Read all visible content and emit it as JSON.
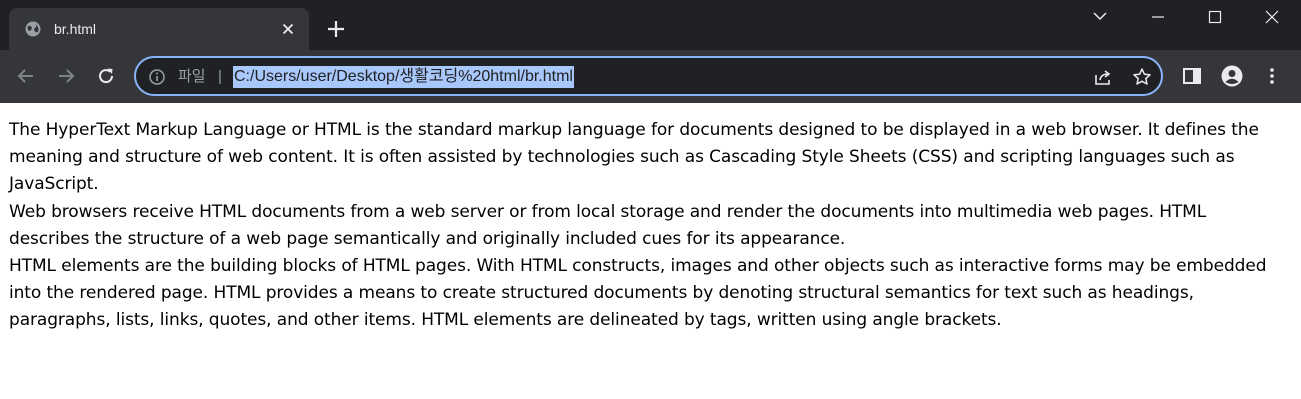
{
  "tab": {
    "title": "br.html",
    "favicon": "globe-icon"
  },
  "window_controls": [
    "chevron-down-icon",
    "minimize-icon",
    "maximize-icon",
    "close-icon"
  ],
  "toolbar": {
    "back": "back-arrow-icon",
    "forward": "forward-arrow-icon",
    "reload": "reload-icon"
  },
  "omnibox": {
    "scheme_label": "파일",
    "separator": "|",
    "url": "C:/Users/user/Desktop/생활코딩%20html/br.html",
    "highlight_color": "#a8c7fa",
    "border_color": "#8ab4f8"
  },
  "content": {
    "lines": [
      "The HyperText Markup Language or HTML is the standard markup language for documents designed to be displayed in a web browser. It defines the meaning and structure of web content. It is often assisted by technologies such as Cascading Style Sheets (CSS) and scripting languages such as JavaScript.",
      "Web browsers receive HTML documents from a web server or from local storage and render the documents into multimedia web pages. HTML describes the structure of a web page semantically and originally included cues for its appearance.",
      "HTML elements are the building blocks of HTML pages. With HTML constructs, images and other objects such as interactive forms may be embedded into the rendered page. HTML provides a means to create structured documents by denoting structural semantics for text such as headings, paragraphs, lists, links, quotes, and other items. HTML elements are delineated by tags, written using angle brackets."
    ]
  },
  "colors": {
    "tabstrip_bg": "#202124",
    "toolbar_bg": "#35363a",
    "icon": "#e8eaed"
  }
}
